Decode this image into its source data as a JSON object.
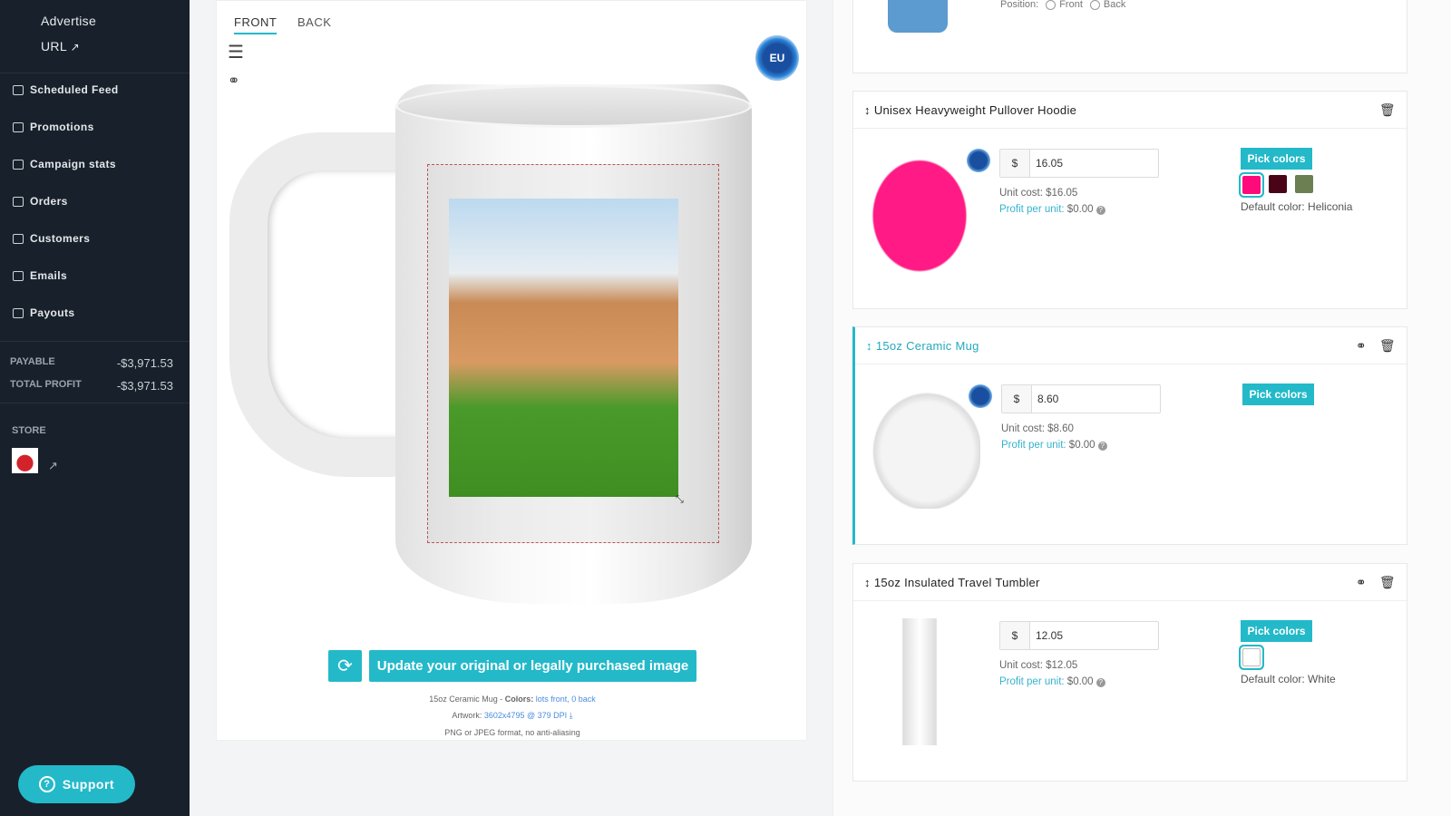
{
  "sidebar": {
    "subitems": [
      "Advertise",
      "URL"
    ],
    "items": [
      {
        "label": "Scheduled Feed",
        "icon": "rss-icon"
      },
      {
        "label": "Promotions",
        "icon": "tag-icon"
      },
      {
        "label": "Campaign stats",
        "icon": "bar-chart-icon"
      },
      {
        "label": "Orders",
        "icon": "inbox-icon"
      },
      {
        "label": "Customers",
        "icon": "users-icon"
      },
      {
        "label": "Emails",
        "icon": "envelope-icon"
      },
      {
        "label": "Payouts",
        "icon": "money-icon"
      }
    ],
    "payable_label": "PAYABLE",
    "payable": "-$3,971.53",
    "profit_label": "TOTAL PROFIT",
    "profit": "-$3,971.53",
    "store_label": "STORE",
    "support": "Support"
  },
  "editor": {
    "tabs": [
      "FRONT",
      "BACK"
    ],
    "badge": "EU",
    "update_label": "Update your original or legally purchased image",
    "product": "15oz Ceramic Mug",
    "colors_label": "Colors:",
    "colors_value": "lots front, 0 back",
    "artwork_label": "Artwork:",
    "artwork_value": "3602x4795 @ 379 DPI",
    "format_note": "PNG or JPEG format, no anti-aliasing"
  },
  "top_card": {
    "position_label": "Position:",
    "options": [
      "Front",
      "Back"
    ]
  },
  "products": [
    {
      "name": "Unisex Heavyweight Pullover Hoodie",
      "price": "16.05",
      "currency": "$",
      "unit_cost": "Unit cost: $16.05",
      "profit_label": "Profit per unit:",
      "profit": "$0.00",
      "pick": "Pick colors",
      "swatches": [
        "#ff0a7a",
        "#4a0418",
        "#6b7f52"
      ],
      "default_color": "Default color: Heliconia",
      "selected": false
    },
    {
      "name": "15oz Ceramic Mug",
      "price": "8.60",
      "currency": "$",
      "unit_cost": "Unit cost: $8.60",
      "profit_label": "Profit per unit:",
      "profit": "$0.00",
      "pick": "Pick colors",
      "swatches": [],
      "default_color": "",
      "selected": true
    },
    {
      "name": "15oz Insulated Travel Tumbler",
      "price": "12.05",
      "currency": "$",
      "unit_cost": "Unit cost: $12.05",
      "profit_label": "Profit per unit:",
      "profit": "$0.00",
      "pick": "Pick colors",
      "swatches": [
        "#ffffff"
      ],
      "default_color": "Default color: White",
      "selected": false
    }
  ],
  "accent": "#23b9c9"
}
